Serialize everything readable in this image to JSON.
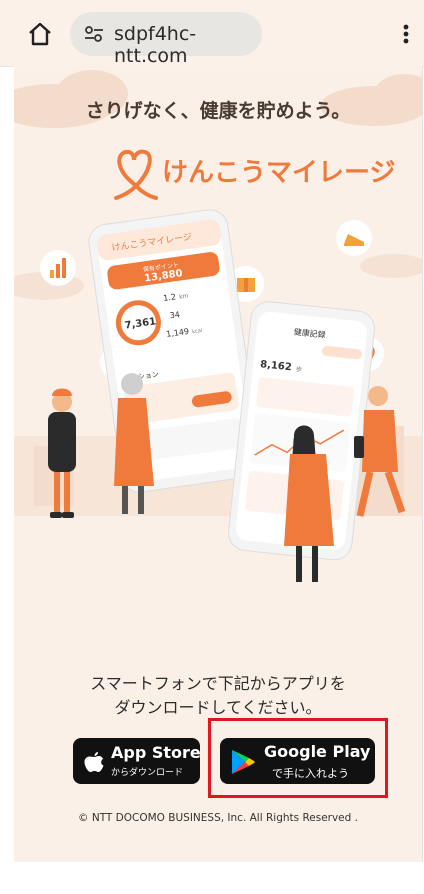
{
  "browser": {
    "url": "sdpf4hc-ntt.com",
    "home_icon": "home-icon",
    "site_settings_icon": "tune-icon",
    "menu_icon": "more-vert-icon"
  },
  "hero": {
    "tagline": "さりげなく、健康を貯めよう。",
    "brand_name": "けんこうマイレージ",
    "brand_color": "#ef7a3b",
    "phone1": {
      "app_title": "けんこうマイレージ",
      "points_label": "保有ポイント",
      "points": "13,880",
      "steps": "7,361",
      "steps_unit": "歩",
      "distance": "1.2",
      "distance_unit": "km",
      "floors": "34",
      "calories": "1,149",
      "calories_unit": "kcal",
      "mission_label": "ミッション"
    },
    "phone2": {
      "header": "健康記録",
      "steps": "8,162",
      "steps_unit": "歩"
    }
  },
  "download": {
    "instruction_line1": "スマートフォンで下記からアプリを",
    "instruction_line2": "ダウンロードしてください。",
    "app_store": {
      "title": "App Store",
      "subtitle": "からダウンロード"
    },
    "google_play": {
      "title": "Google Play",
      "subtitle": "で手に入れよう"
    },
    "highlight_color": "#e2161d"
  },
  "footer": {
    "copyright": "© NTT DOCOMO BUSINESS, Inc. All Rights Reserved ."
  }
}
